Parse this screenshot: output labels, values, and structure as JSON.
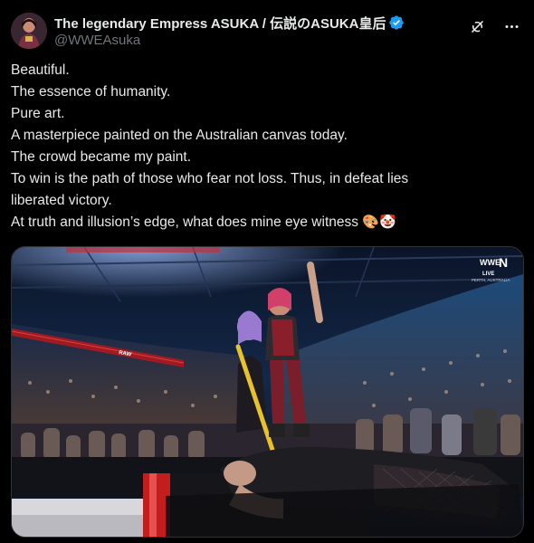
{
  "author": {
    "display_name": "The legendary Empress ASUKA / 伝説のASUKA皇后",
    "handle": "@WWEAsuka",
    "verified": true,
    "avatar_icon": "profile-avatar"
  },
  "header_actions": {
    "grok_icon": "grok-icon",
    "more_icon": "more-icon"
  },
  "tweet": {
    "lines": [
      "Beautiful.",
      "The essence of humanity.",
      "Pure art.",
      "A masterpiece painted on the Australian canvas today.",
      "The crowd became my paint.",
      "To win is the path of those who fear not loss. Thus, in defeat lies",
      "liberated victory.",
      "At truth and illusion’s edge, what does mine eye witness"
    ],
    "emojis": [
      "🎨",
      "🤡"
    ]
  },
  "media": {
    "watermark_logo": "WWE",
    "broadcast_label": "LIVE",
    "broadcast_location": "PERTH, AUSTRALIA",
    "network_logo": "N",
    "ring_banner": "RAW"
  },
  "colors": {
    "background": "#000000",
    "text": "#e7e9ea",
    "secondary_text": "#71767b",
    "verified_blue": "#1d9bf0",
    "border": "#2f3336"
  }
}
